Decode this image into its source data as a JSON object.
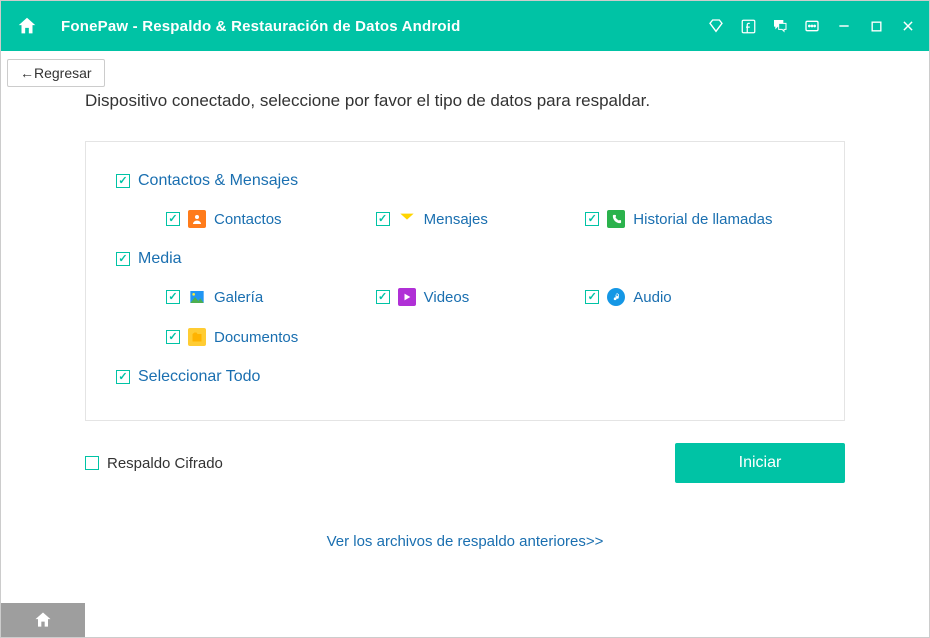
{
  "titlebar": {
    "brand": "FonePaw",
    "separator": " -  ",
    "subtitle": "Respaldo & Restauración de Datos Android"
  },
  "back_button": "←Regresar",
  "instruction": "Dispositivo conectado, seleccione por favor el tipo de datos para respaldar.",
  "groups": {
    "contacts_messages": {
      "label": "Contactos & Mensajes",
      "items": {
        "contacts": "Contactos",
        "messages": "Mensajes",
        "call_log": "Historial de llamadas"
      }
    },
    "media": {
      "label": "Media",
      "items": {
        "gallery": "Galería",
        "videos": "Videos",
        "audio": "Audio",
        "documents": "Documentos"
      }
    }
  },
  "select_all": "Seleccionar Todo",
  "encrypted_backup": "Respaldo Cifrado",
  "start_button": "Iniciar",
  "previous_link": "Ver los archivos de respaldo anteriores>>"
}
